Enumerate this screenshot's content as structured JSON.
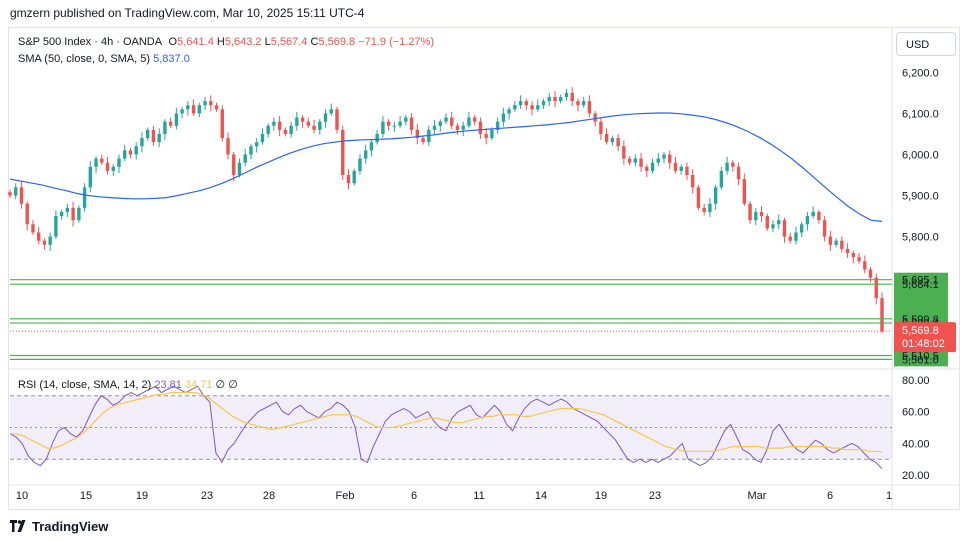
{
  "header": {
    "published": "gmzern published on TradingView.com, Mar 10, 2025 15:11 UTC-4",
    "currency_button": "USD",
    "footer_brand": "TradingView"
  },
  "legend": {
    "symbol": "S&P 500 Index · 4h · OANDA",
    "o_label": "O",
    "o_value": "5,641.4",
    "h_label": "H",
    "h_value": "5,643.2",
    "l_label": "L",
    "l_value": "5,567.4",
    "c_label": "C",
    "c_value": "5,569.8",
    "change": "−71.9 (−1.27%)",
    "sma_label": "SMA (50, close, 0, SMA, 5)",
    "sma_value": "5,837.0",
    "rsi_label": "RSI (14, close, SMA, 14, 2)",
    "rsi_value": "23.81",
    "rsi_ma_value": "34.71",
    "rsi_extra1": "∅",
    "rsi_extra2": "∅"
  },
  "colors": {
    "up": "#26a69a",
    "down": "#ef5350",
    "sma": "#2962ff",
    "rsi": "#7e57c2",
    "rsi_ma": "#f7c748",
    "level": "#4caf50",
    "price_tag": "#ef5350"
  },
  "chart_data": [
    {
      "type": "candlestick",
      "title": "S&P 500 Index · 4h · OANDA",
      "ylim": [
        5480,
        6235
      ],
      "x_ticks": [
        "10",
        "15",
        "19",
        "23",
        "28",
        "Feb",
        "6",
        "11",
        "14",
        "19",
        "23",
        "Mar",
        "6",
        "1"
      ],
      "y_ticks": [
        "6,200.0",
        "6,100.0",
        "6,000.0",
        "5,900.0",
        "5,800.0"
      ],
      "level_lines": [
        5695.1,
        5684.1,
        5599.8,
        5589.4,
        5510.5,
        5501.0
      ],
      "level_labels": [
        "5,695.1",
        "5,684.1",
        "5,599.8",
        "5,589.4",
        "5,510.5",
        "5,501.0"
      ],
      "last_price": 5569.8,
      "last_price_label": "5,569.8",
      "countdown": "01:48:02",
      "closes": [
        5900,
        5920,
        5880,
        5830,
        5810,
        5790,
        5780,
        5800,
        5850,
        5860,
        5870,
        5840,
        5870,
        5920,
        5970,
        5990,
        5980,
        5960,
        5970,
        5990,
        6010,
        6000,
        6020,
        6040,
        6060,
        6030,
        6050,
        6080,
        6070,
        6100,
        6110,
        6120,
        6100,
        6120,
        6130,
        6120,
        6110,
        6040,
        6000,
        5950,
        5980,
        6000,
        6020,
        6030,
        6050,
        6070,
        6080,
        6060,
        6050,
        6070,
        6090,
        6080,
        6070,
        6060,
        6080,
        6100,
        6110,
        6060,
        5950,
        5930,
        5960,
        5990,
        6010,
        6030,
        6050,
        6080,
        6070,
        6070,
        6080,
        6090,
        6060,
        6040,
        6030,
        6060,
        6070,
        6080,
        6090,
        6070,
        6060,
        6070,
        6090,
        6080,
        6050,
        6040,
        6060,
        6080,
        6100,
        6110,
        6120,
        6130,
        6120,
        6110,
        6120,
        6130,
        6140,
        6130,
        6140,
        6150,
        6130,
        6120,
        6130,
        6100,
        6080,
        6050,
        6030,
        6040,
        6020,
        5990,
        5980,
        5990,
        5970,
        5960,
        5980,
        5990,
        6000,
        5980,
        5960,
        5970,
        5950,
        5920,
        5870,
        5860,
        5880,
        5920,
        5960,
        5980,
        5970,
        5940,
        5880,
        5840,
        5860,
        5850,
        5820,
        5830,
        5840,
        5800,
        5790,
        5810,
        5830,
        5850,
        5860,
        5840,
        5800,
        5780,
        5790,
        5770,
        5760,
        5750,
        5740,
        5720,
        5700,
        5650,
        5570
      ],
      "sma50": [
        5940,
        5935,
        5930,
        5925,
        5918,
        5912,
        5905,
        5900,
        5897,
        5895,
        5893,
        5892,
        5892,
        5893,
        5895,
        5900,
        5906,
        5912,
        5920,
        5930,
        5942,
        5955,
        5968,
        5980,
        5992,
        6003,
        6012,
        6020,
        6026,
        6030,
        6033,
        6035,
        6036,
        6037,
        6038,
        6040,
        6042,
        6045,
        6048,
        6052,
        6055,
        6058,
        6060,
        6062,
        6064,
        6066,
        6068,
        6070,
        6072,
        6075,
        6078,
        6082,
        6086,
        6090,
        6094,
        6097,
        6099,
        6100,
        6101,
        6101,
        6099,
        6096,
        6092,
        6086,
        6078,
        6068,
        6056,
        6042,
        6026,
        6008,
        5988,
        5966,
        5942,
        5918,
        5895,
        5873,
        5855,
        5840,
        5837
      ]
    },
    {
      "type": "line",
      "title": "RSI (14, close, SMA, 14, 2)",
      "ylim": [
        15,
        85
      ],
      "y_ticks": [
        "80.00",
        "60.00",
        "40.00",
        "20.00"
      ],
      "bands": [
        70,
        50,
        30
      ],
      "rsi": [
        46,
        44,
        40,
        32,
        28,
        26,
        30,
        40,
        48,
        50,
        46,
        44,
        48,
        56,
        64,
        70,
        68,
        64,
        66,
        70,
        72,
        70,
        72,
        74,
        76,
        72,
        74,
        76,
        74,
        72,
        74,
        76,
        70,
        66,
        34,
        28,
        36,
        40,
        46,
        52,
        56,
        60,
        62,
        64,
        66,
        60,
        58,
        62,
        64,
        60,
        58,
        56,
        60,
        62,
        66,
        64,
        60,
        50,
        30,
        28,
        38,
        46,
        54,
        58,
        60,
        62,
        60,
        56,
        58,
        60,
        54,
        50,
        48,
        56,
        60,
        62,
        64,
        58,
        56,
        60,
        64,
        60,
        52,
        48,
        56,
        62,
        66,
        68,
        66,
        64,
        66,
        68,
        66,
        62,
        60,
        58,
        56,
        54,
        50,
        46,
        42,
        36,
        30,
        28,
        30,
        28,
        30,
        28,
        30,
        32,
        36,
        40,
        30,
        28,
        26,
        28,
        32,
        40,
        48,
        52,
        44,
        36,
        34,
        30,
        28,
        36,
        48,
        52,
        46,
        40,
        36,
        34,
        38,
        42,
        40,
        36,
        34,
        36,
        38,
        40,
        38,
        34,
        30,
        28,
        24
      ],
      "rsi_ma": [
        46,
        46,
        45,
        43,
        41,
        39,
        37,
        37,
        38,
        40,
        42,
        44,
        47,
        51,
        55,
        59,
        62,
        64,
        65,
        66,
        67,
        68,
        69,
        70,
        71,
        71,
        72,
        72,
        72,
        72,
        72,
        71,
        69,
        66,
        63,
        60,
        57,
        55,
        53,
        52,
        51,
        50,
        49,
        49,
        50,
        51,
        52,
        53,
        54,
        55,
        56,
        57,
        58,
        58,
        58,
        58,
        57,
        55,
        53,
        51,
        50,
        50,
        50,
        51,
        52,
        53,
        54,
        55,
        56,
        56,
        55,
        54,
        53,
        53,
        54,
        55,
        56,
        57,
        57,
        58,
        58,
        58,
        58,
        57,
        57,
        58,
        59,
        60,
        61,
        62,
        62,
        62,
        62,
        61,
        60,
        59,
        58,
        56,
        54,
        52,
        50,
        48,
        46,
        44,
        42,
        40,
        38,
        37,
        36,
        35,
        35,
        35,
        35,
        35,
        35,
        36,
        37,
        38,
        38,
        38,
        38,
        38,
        37,
        37,
        37,
        37,
        38,
        38,
        38,
        38,
        38,
        38,
        38,
        37,
        37,
        36,
        36,
        36,
        36,
        35,
        35,
        34.71
      ]
    }
  ]
}
